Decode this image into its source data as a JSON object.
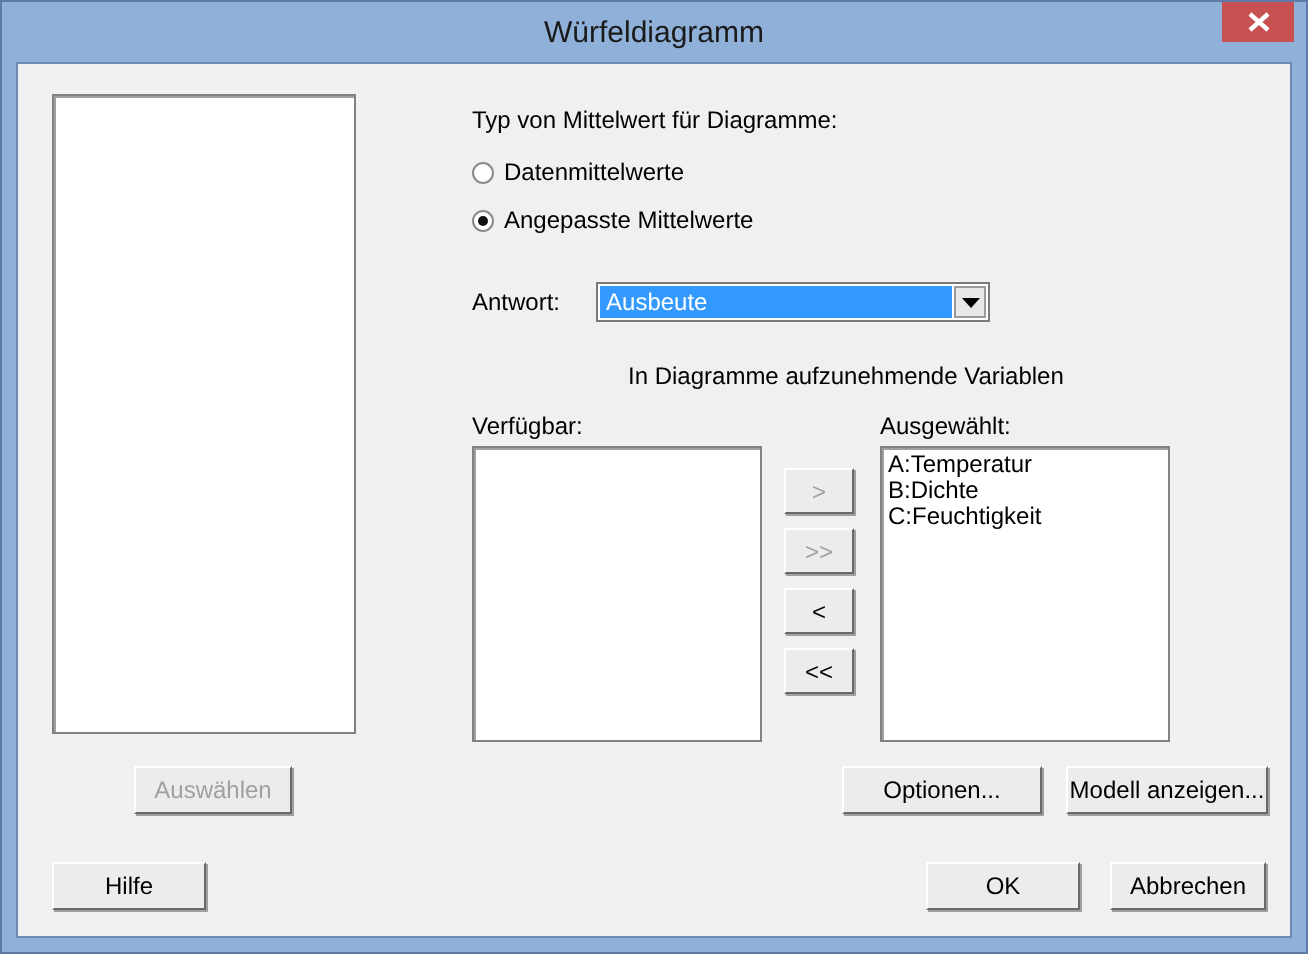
{
  "window": {
    "title": "Würfeldiagramm"
  },
  "mean_type": {
    "label": "Typ von Mittelwert für Diagramme:",
    "options": [
      {
        "label": "Datenmittelwerte",
        "selected": false
      },
      {
        "label": "Angepasste Mittelwerte",
        "selected": true
      }
    ]
  },
  "response": {
    "label": "Antwort:",
    "value": "Ausbeute"
  },
  "variables_heading": "In Diagramme aufzunehmende Variablen",
  "available": {
    "label": "Verfügbar:"
  },
  "chosen": {
    "label": "Ausgewählt:",
    "items": [
      "A:Temperatur",
      "B:Dichte",
      "C:Feuchtigkeit"
    ]
  },
  "transfer_buttons": [
    {
      "label": ">",
      "disabled": true
    },
    {
      "label": ">>",
      "disabled": true
    },
    {
      "label": "<",
      "disabled": false
    },
    {
      "label": "<<",
      "disabled": false
    }
  ],
  "select_button": {
    "label": "Auswählen",
    "disabled": true
  },
  "options_button": "Optionen...",
  "model_button": "Modell anzeigen...",
  "help_button": "Hilfe",
  "ok_button": "OK",
  "cancel_button": "Abbrechen"
}
